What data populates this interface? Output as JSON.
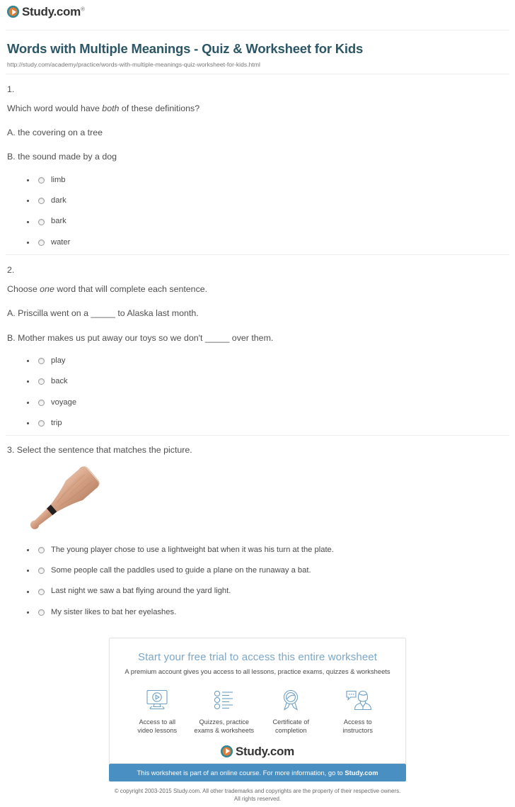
{
  "header": {
    "logo_text": "Study",
    "logo_suffix": ".com",
    "logo_trademark": "®",
    "title": "Words with Multiple Meanings - Quiz & Worksheet for Kids",
    "url": "http://study.com/academy/practice/words-with-multiple-meanings-quiz-worksheet-for-kids.html"
  },
  "questions": [
    {
      "number": "1.",
      "stem_before": "Which word would have ",
      "stem_em": "both",
      "stem_after": " of these definitions?",
      "lines": [
        "A. the covering on a tree",
        "B. the sound made by a dog"
      ],
      "options": [
        "limb",
        "dark",
        "bark",
        "water"
      ]
    },
    {
      "number": "2.",
      "stem_before": "Choose ",
      "stem_em": "one",
      "stem_after": " word that will complete each sentence.",
      "lines": [
        "A. Priscilla went on a _____ to Alaska last month.",
        "B. Mother makes us put away our toys so we don't _____ over them."
      ],
      "options": [
        "play",
        "back",
        "voyage",
        "trip"
      ]
    },
    {
      "number": "3. Select the sentence that matches the picture.",
      "image_alt": "baseball-bat",
      "options": [
        "The young player chose to use a lightweight bat when it was his turn at the plate.",
        "Some people call the paddles used to guide a plane on the runaway a bat.",
        "Last night we saw a bat flying around the yard light.",
        "My sister likes to bat her eyelashes."
      ]
    }
  ],
  "promo": {
    "title": "Start your free trial to access this entire worksheet",
    "subtitle": "A premium account gives you access to all lessons, practice exams, quizzes & worksheets",
    "features": [
      {
        "icon": "monitor-play-icon",
        "label_line1": "Access to all",
        "label_line2": "video lessons"
      },
      {
        "icon": "checklist-icon",
        "label_line1": "Quizzes, practice",
        "label_line2": "exams & worksheets"
      },
      {
        "icon": "award-ribbon-icon",
        "label_line1": "Certificate of",
        "label_line2": "completion"
      },
      {
        "icon": "instructor-chat-icon",
        "label_line1": "Access to",
        "label_line2": "instructors"
      }
    ],
    "logo_text": "Study",
    "logo_suffix": ".com",
    "banner_text_before": "This worksheet is part of an online course. For more information, go to ",
    "banner_link": "Study.com"
  },
  "footer": {
    "line1": "© copyright 2003-2015 Study.com. All other trademarks and copyrights are the property of their respective owners.",
    "line2": "All rights reserved."
  },
  "colors": {
    "title": "#2c5666",
    "promo_title": "#7ba7c9",
    "banner": "#4a8fc2",
    "logo_orange": "#e07b39",
    "logo_teal": "#2e8a9a",
    "bat_wood": "#d4a083",
    "icon_blue": "#6e9fc4"
  }
}
